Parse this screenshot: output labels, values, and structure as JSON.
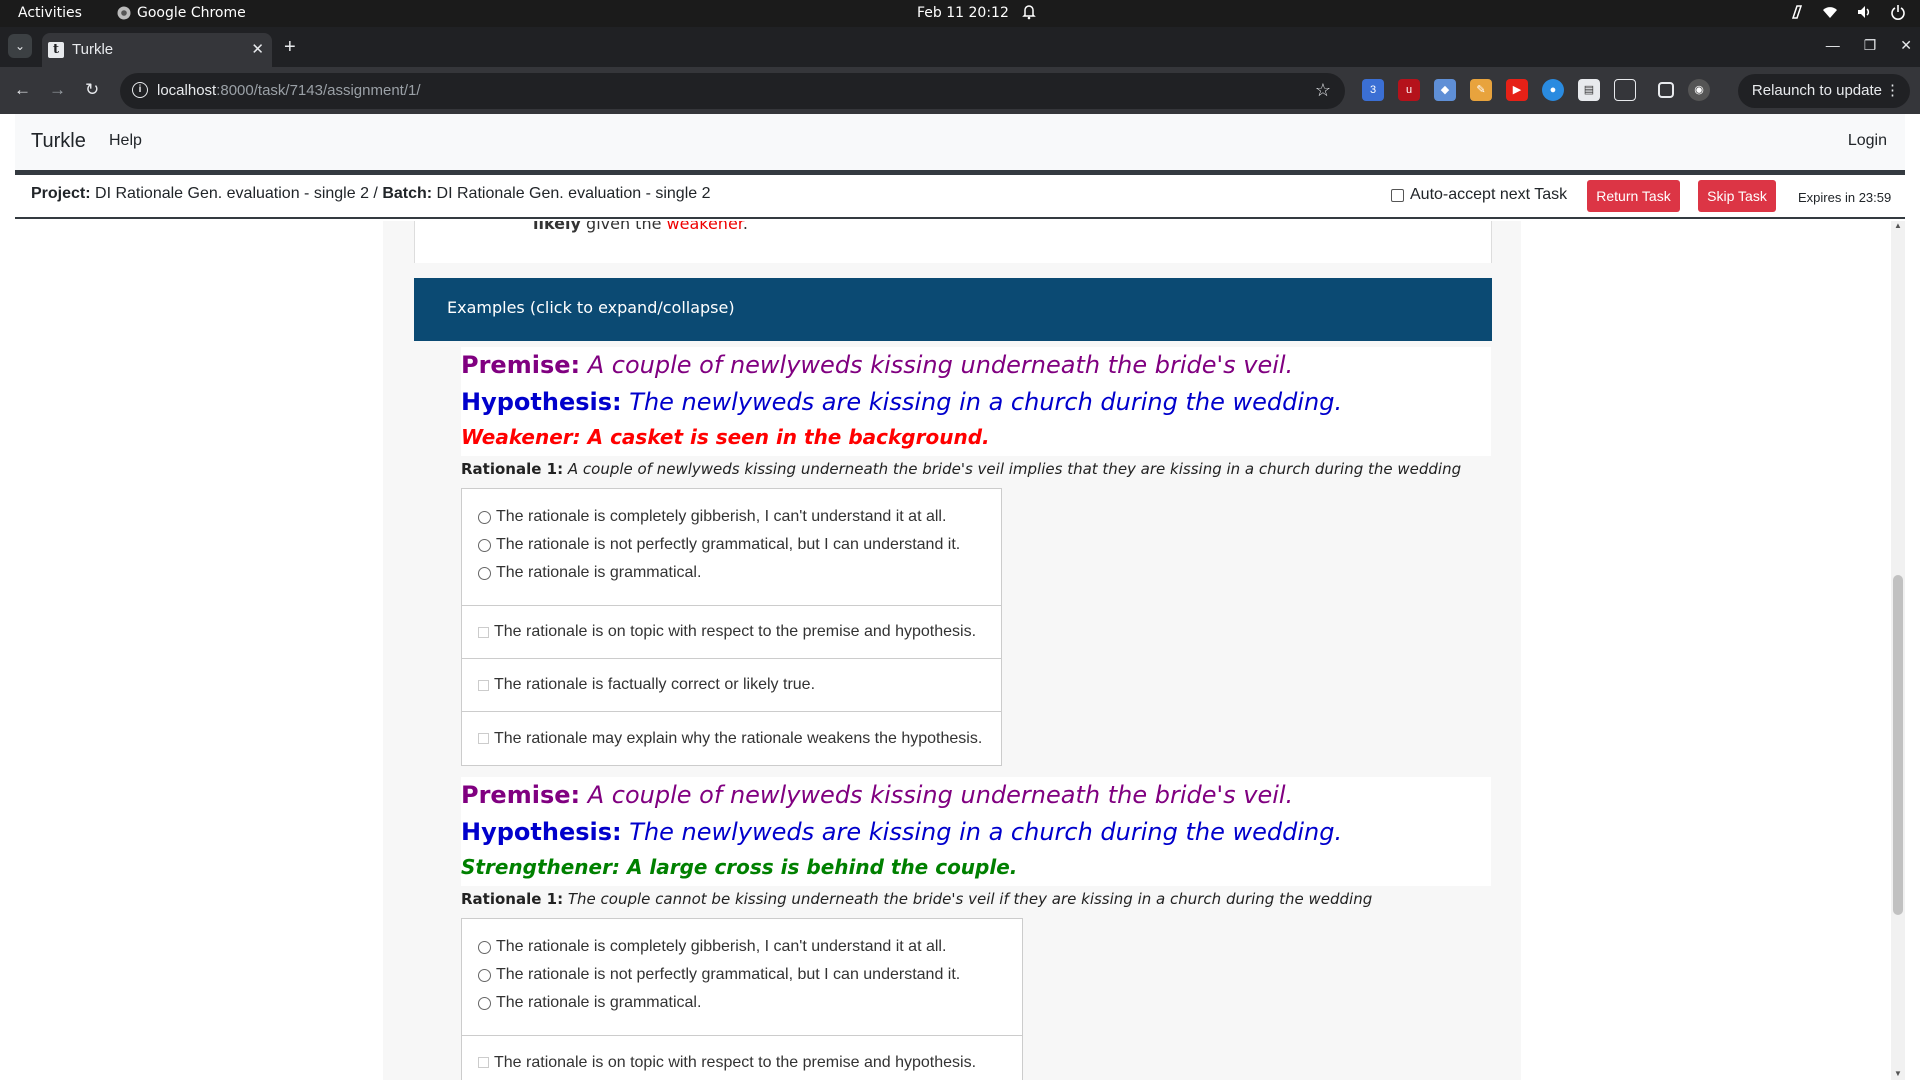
{
  "system_bar": {
    "activities": "Activities",
    "app_name": "Google Chrome",
    "clock": "Feb 11  20:12"
  },
  "browser": {
    "tab_title": "Turkle",
    "url_host": "localhost",
    "url_path": ":8000/task/7143/assignment/1/",
    "relaunch_label": "Relaunch to update"
  },
  "site": {
    "brand": "Turkle",
    "help": "Help",
    "login": "Login"
  },
  "task": {
    "project_label": "Project:",
    "project_name": "DI Rationale Gen. evaluation - single 2",
    "separator": " / ",
    "batch_label": "Batch:",
    "batch_name": "DI Rationale Gen. evaluation - single 2",
    "auto_accept": "Auto-accept next Task",
    "return_task": "Return Task",
    "skip_task": "Skip Task",
    "expires": "Expires in 23:59"
  },
  "instructions": {
    "bold": "likely",
    "mid": " given the ",
    "red": "weakener",
    "end": "."
  },
  "examples_header": "Examples (click to expand/collapse)",
  "questions": {
    "gibberish": "The rationale is completely gibberish, I can't understand it at all.",
    "not_grammatical": "The rationale is not perfectly grammatical, but I can understand it.",
    "grammatical": "The rationale is grammatical.",
    "on_topic": "The rationale is on topic with respect to the premise and hypothesis.",
    "factual": "The rationale is factually correct or likely true.",
    "explains": "The rationale may explain why the rationale weakens the hypothesis."
  },
  "examples": [
    {
      "premise_label": "Premise:",
      "premise": "A couple of newlyweds kissing underneath the bride's veil.",
      "hypothesis_label": "Hypothesis:",
      "hypothesis": "The newlyweds are kissing in a church during the wedding.",
      "modifier": "Weakener: A casket is seen in the background.",
      "modifier_color": "#ff0000",
      "rationale_label": "Rationale 1:",
      "rationale": "A couple of newlyweds kissing underneath the bride's veil implies that they are kissing in a church during the wedding"
    },
    {
      "premise_label": "Premise:",
      "premise": "A couple of newlyweds kissing underneath the bride's veil.",
      "hypothesis_label": "Hypothesis:",
      "hypothesis": "The newlyweds are kissing in a church during the wedding.",
      "modifier": "Strengthener: A large cross is behind the couple.",
      "modifier_color": "#008000",
      "rationale_label": "Rationale 1:",
      "rationale": "The couple cannot be kissing underneath the bride's veil if they are kissing in a church during the wedding"
    }
  ],
  "colors": {
    "premise": "#800080",
    "hypothesis": "#0000cc",
    "header_bg": "#0b4a73",
    "button_red": "#dc3545"
  }
}
